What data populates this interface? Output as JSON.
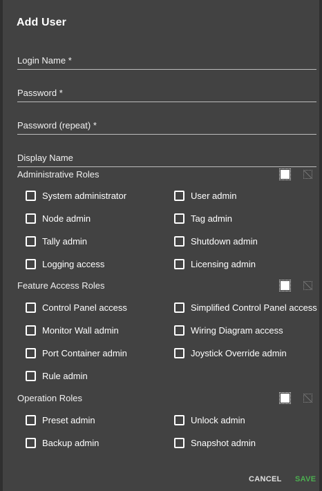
{
  "dialog": {
    "title": "Add User",
    "fields": [
      {
        "label": "Login Name *",
        "value": ""
      },
      {
        "label": "Password *",
        "value": ""
      },
      {
        "label": "Password (repeat) *",
        "value": ""
      },
      {
        "label": "Display Name",
        "value": ""
      }
    ],
    "sections": {
      "administrative": {
        "title": "Administrative Roles",
        "left": [
          "System administrator",
          "Node admin",
          "Tally admin",
          "Logging access"
        ],
        "right": [
          "User admin",
          "Tag admin",
          "Shutdown admin",
          "Licensing admin"
        ]
      },
      "feature": {
        "title": "Feature Access Roles",
        "left": [
          "Control Panel access",
          "Monitor Wall admin",
          "Port Container admin",
          "Rule admin"
        ],
        "right": [
          "Simplified Control Panel access",
          "Wiring Diagram access",
          "Joystick Override admin"
        ]
      },
      "operation": {
        "title": "Operation Roles",
        "left": [
          "Preset admin",
          "Backup admin"
        ],
        "right": [
          "Unlock admin",
          "Snapshot admin"
        ]
      }
    },
    "actions": {
      "cancel": "CANCEL",
      "save": "SAVE"
    },
    "colors": {
      "background": "#424242",
      "accent": "#4caf50"
    }
  }
}
